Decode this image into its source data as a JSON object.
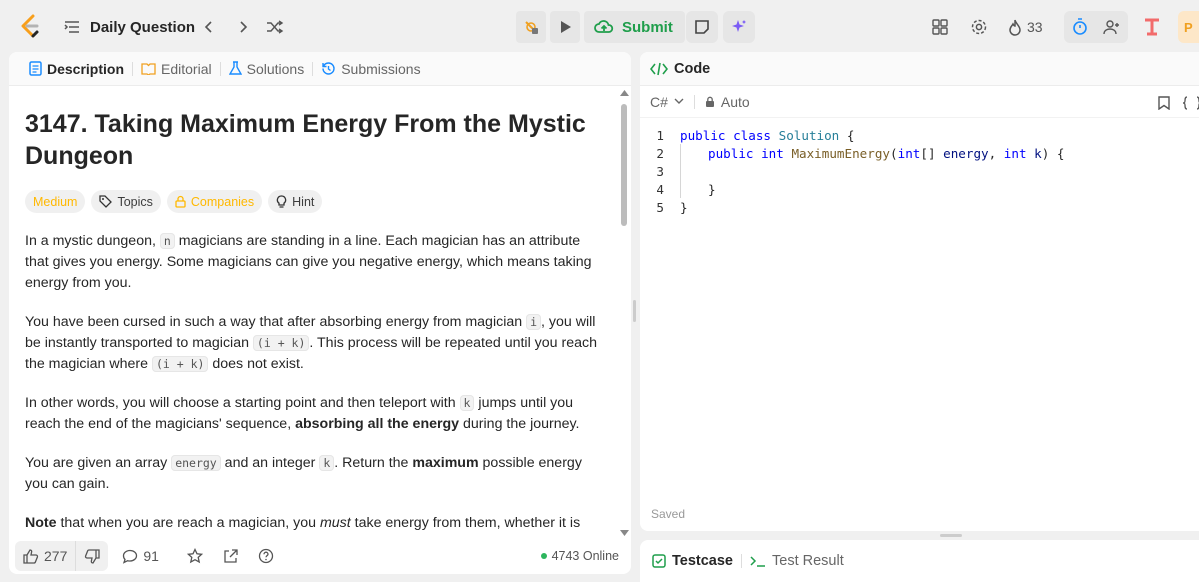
{
  "topbar": {
    "daily_question": "Daily Question",
    "submit_label": "Submit",
    "streak_count": "33"
  },
  "tabs": {
    "description": "Description",
    "editorial": "Editorial",
    "solutions": "Solutions",
    "submissions": "Submissions"
  },
  "problem": {
    "title": "3147. Taking Maximum Energy From the Mystic Dungeon",
    "difficulty": "Medium",
    "topics": "Topics",
    "companies": "Companies",
    "hint": "Hint",
    "p1_a": "In a mystic dungeon, ",
    "p1_code": "n",
    "p1_b": " magicians are standing in a line. Each magician has an attribute that gives you energy. Some magicians can give you negative energy, which means taking energy from you.",
    "p2_a": "You have been cursed in such a way that after absorbing energy from magician ",
    "p2_code1": "i",
    "p2_b": ", you will be instantly transported to magician ",
    "p2_code2": "(i + k)",
    "p2_c": ". This process will be repeated until you reach the magician where ",
    "p2_code3": "(i + k)",
    "p2_d": " does not exist.",
    "p3_a": "In other words, you will choose a starting point and then teleport with ",
    "p3_code": "k",
    "p3_b": " jumps until you reach the end of the magicians' sequence, ",
    "p3_bold": "absorbing all the energy",
    "p3_c": " during the journey.",
    "p4_a": "You are given an array ",
    "p4_code1": "energy",
    "p4_b": " and an integer ",
    "p4_code2": "k",
    "p4_c": ". Return the ",
    "p4_bold": "maximum",
    "p4_d": " possible energy you can gain.",
    "p5_bold": "Note",
    "p5_a": " that when you are reach a magician, you ",
    "p5_em": "must",
    "p5_b": " take energy from them, whether it is negative or positive energy."
  },
  "footer": {
    "likes": "277",
    "comments": "91",
    "online": "4743 Online"
  },
  "code": {
    "header": "Code",
    "language": "C#",
    "mode": "Auto",
    "line_numbers": [
      "1",
      "2",
      "3",
      "4",
      "5"
    ],
    "saved": "Saved"
  },
  "test": {
    "testcase": "Testcase",
    "result": "Test Result"
  },
  "colors": {
    "accent_green": "#1f9e4b",
    "medium_yellow": "#ffb800",
    "keyword_blue": "#0000ff"
  }
}
